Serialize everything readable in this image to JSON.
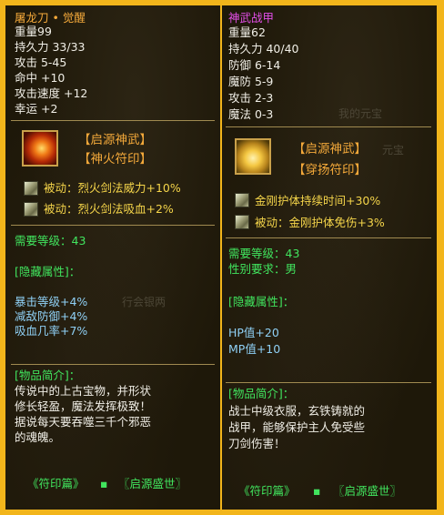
{
  "left": {
    "title": "屠龙刀 • 觉醒",
    "stats": [
      "重量99",
      "持久力 33/33",
      "攻击 5-45",
      "命中 +10",
      "攻击速度 +12",
      "幸运 +2"
    ],
    "seals": [
      "【启源神武】",
      "【神火符印】"
    ],
    "passives": [
      "被动：烈火剑法威力+10%",
      "被动：烈火剑法吸血+2%"
    ],
    "requirements": [
      "需要等级：43"
    ],
    "hidden_header": "[隐藏属性]：",
    "hidden_attrs": [
      "暴击等级+4%",
      "减敌防御+4%",
      "吸血几率+7%"
    ],
    "desc_header": "[物品简介]：",
    "desc_lines": [
      "传说中的上古宝物，并形状",
      "修长轻盈，魔法发挥极致！",
      "据说每天要吞噬三千个邪恶",
      "的魂魄。"
    ],
    "footer": [
      "《符印篇》",
      "▪",
      "〖启源盛世〗"
    ],
    "background_text": [
      "行会银两"
    ]
  },
  "right": {
    "title": "神武战甲",
    "stats": [
      "重量62",
      "持久力 40/40",
      "防御 6-14",
      "魔防 5-9",
      "攻击 2-3",
      "魔法 0-3"
    ],
    "seals": [
      "【启源神武】",
      "【穿扬符印】"
    ],
    "passives": [
      "金刚护体持续时间+30%",
      "被动：金刚护体免伤+3%"
    ],
    "requirements": [
      "需要等级：43",
      "性别要求：男"
    ],
    "hidden_header": "[隐藏属性]：",
    "hidden_attrs": [
      "HP值+20",
      "MP值+10"
    ],
    "desc_header": "[物品简介]：",
    "desc_lines": [
      "战士中级衣服，玄铁铸就的",
      "战甲，能够保护主人免受些",
      "刀剑伤害！"
    ],
    "footer": [
      "《符印篇》",
      "▪",
      "〖启源盛世〗"
    ],
    "background_text": [
      "我的元宝",
      "元宝"
    ]
  },
  "colors": {
    "frame": "#f2b51b",
    "title_left": "#f4a93a",
    "title_right": "#e24ee6",
    "seal": "#f4a93a",
    "section": "#41e55e",
    "hidden_attr": "#8fd0f5",
    "description": "#f0eee6",
    "passive": "#f5d54a"
  },
  "icons": [
    "weapon-icon",
    "armor-icon",
    "passive-skill-icon"
  ]
}
